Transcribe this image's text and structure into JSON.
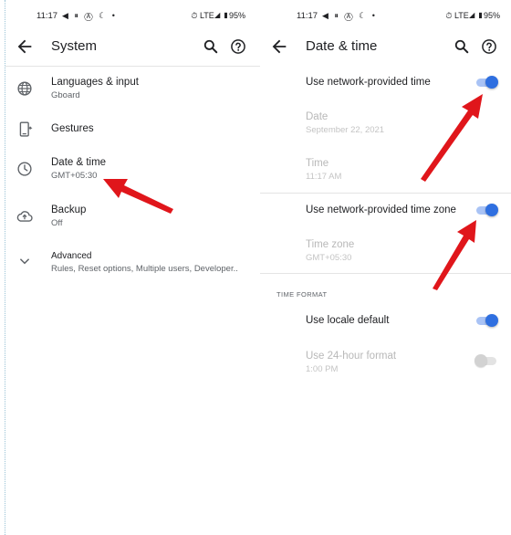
{
  "status_bar": {
    "time": "11:17",
    "notif_icons": "◀ ⏸ Ⓐ ☾ •",
    "right": "⏱ LTE◢ ▮95%"
  },
  "left": {
    "title": "System",
    "items": [
      {
        "title": "Languages & input",
        "subtitle": "Gboard",
        "icon": "globe-icon"
      },
      {
        "title": "Gestures",
        "subtitle": "",
        "icon": "phone-gesture-icon"
      },
      {
        "title": "Date & time",
        "subtitle": "GMT+05:30",
        "icon": "clock-icon"
      },
      {
        "title": "Backup",
        "subtitle": "Off",
        "icon": "cloud-upload-icon"
      },
      {
        "title": "Advanced",
        "subtitle": "Rules, Reset options, Multiple users, Developer..",
        "icon": "chevron-down-icon"
      }
    ]
  },
  "right": {
    "title": "Date & time",
    "network_time": {
      "label": "Use network-provided time",
      "enabled": true
    },
    "date": {
      "label": "Date",
      "value": "September 22, 2021"
    },
    "time": {
      "label": "Time",
      "value": "11:17 AM"
    },
    "network_zone": {
      "label": "Use network-provided time zone",
      "enabled": true
    },
    "time_zone": {
      "label": "Time zone",
      "value": "GMT+05:30"
    },
    "section_header": "TIME FORMAT",
    "locale_default": {
      "label": "Use locale default",
      "enabled": true
    },
    "hour24": {
      "label": "Use 24-hour format",
      "value": "1:00 PM",
      "enabled": false
    }
  },
  "colors": {
    "accent": "#2f6fe0",
    "arrow": "#e0161b"
  }
}
